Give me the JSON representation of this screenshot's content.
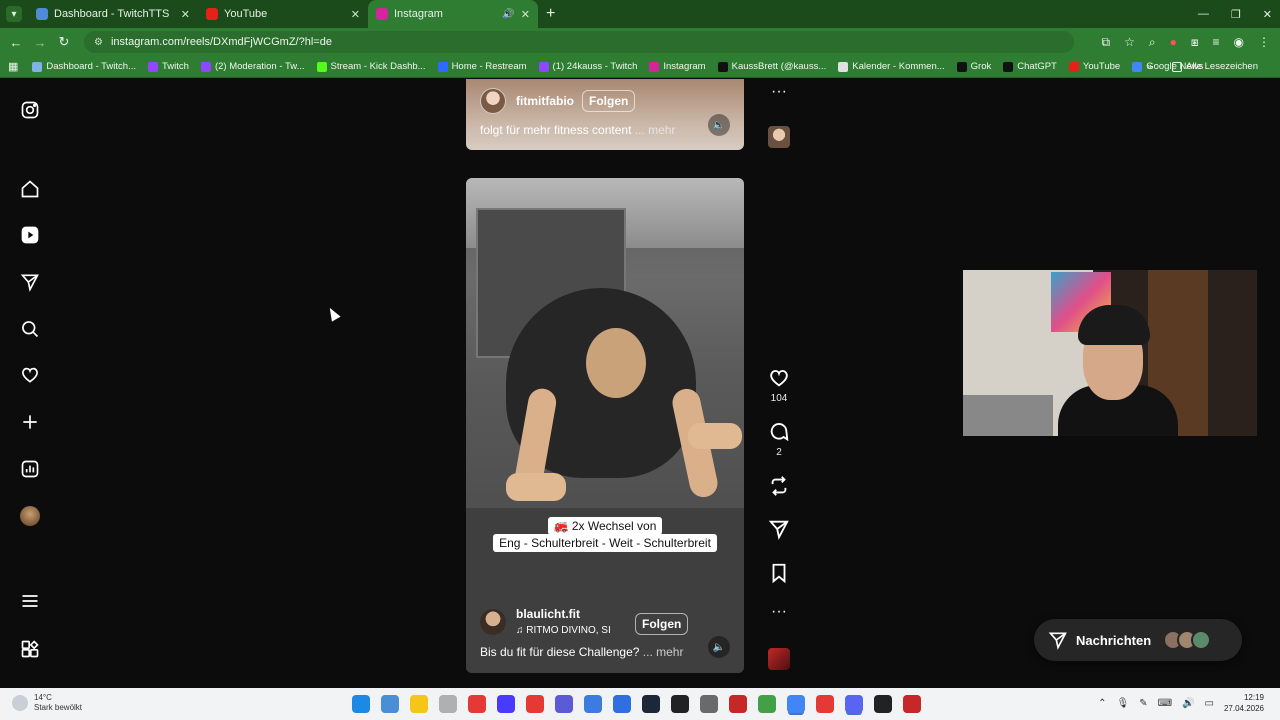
{
  "browser": {
    "tabs": [
      {
        "title": "Dashboard - TwitchTTS",
        "fav_color": "#4f8bd8",
        "active": false
      },
      {
        "title": "YouTube",
        "fav_color": "#e62117",
        "active": false
      },
      {
        "title": "Instagram",
        "fav_color": "#d6249f",
        "active": true
      }
    ],
    "url": "instagram.com/reels/DXmdFjWCGmZ/?hl=de",
    "bookmarks": [
      {
        "label": "Dashboard - Twitch...",
        "color": "#7fb3e8"
      },
      {
        "label": "Twitch",
        "color": "#9146ff"
      },
      {
        "label": "(2) Moderation - Tw...",
        "color": "#9146ff"
      },
      {
        "label": "Stream - Kick Dashb...",
        "color": "#53fc18"
      },
      {
        "label": "Home - Restream",
        "color": "#2e6bff"
      },
      {
        "label": "(1) 24kauss - Twitch",
        "color": "#9146ff"
      },
      {
        "label": "Instagram",
        "color": "#d6249f"
      },
      {
        "label": "KaussBrett (@kauss...",
        "color": "#111111"
      },
      {
        "label": "Kalender - Kommen...",
        "color": "#e0e0e0"
      },
      {
        "label": "Grok",
        "color": "#111111"
      },
      {
        "label": "ChatGPT",
        "color": "#111111"
      },
      {
        "label": "YouTube",
        "color": "#e62117"
      },
      {
        "label": "Google News",
        "color": "#4285f4"
      }
    ],
    "all_bookmarks": "Alle Lesezeichen"
  },
  "reels": {
    "top": {
      "username": "fitmitfabio",
      "follow": "Folgen",
      "caption": "folgt für mehr fitness content",
      "more": "... mehr"
    },
    "main": {
      "overlay_line1": "🚒 2x Wechsel von",
      "overlay_line2": "Eng - Schulterbreit - Weit - Schulterbreit",
      "username": "blaulicht.fit",
      "follow": "Folgen",
      "music": "♫  RITMO DIVINO, SI",
      "caption": "Bis du fit für diese Challenge?",
      "more": "... mehr",
      "likes": "104",
      "comments": "2"
    }
  },
  "messages": {
    "label": "Nachrichten"
  },
  "taskbar": {
    "temp": "14°C",
    "weather": "Stark bewölkt",
    "time": "12:19",
    "date": "27.04.2026",
    "apps": [
      "#1e88e5",
      "#4a8fd6",
      "#f5c518",
      "#b0b0b0",
      "#e53935",
      "#4a3aff",
      "#e53935",
      "#5b5bd6",
      "#3d7be0",
      "#2f6fe0",
      "#1b2838",
      "#222222",
      "#6a6a6a",
      "#c62828",
      "#43a047",
      "#4285f4",
      "#e53935",
      "#5865f2",
      "#222222",
      "#c62828"
    ]
  }
}
